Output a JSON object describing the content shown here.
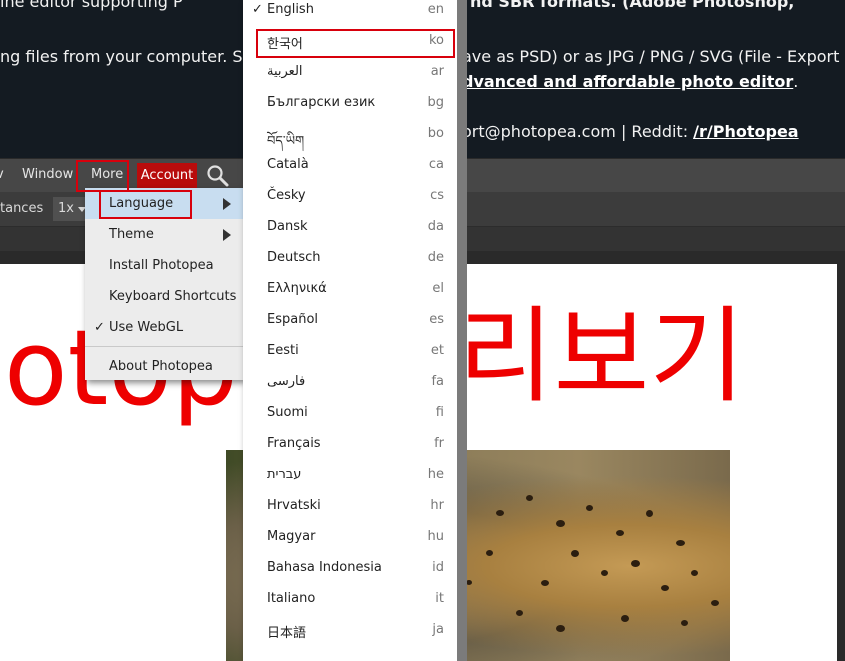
{
  "banner": {
    "line1": "ine editor supporting P",
    "line1b": "nd SBR formats. (Adobe Photoshop,",
    "line2a": "ng files from your computer. Sa",
    "line2b": "ave as PSD) or as JPG / PNG / SVG (File - Export as",
    "line3": "dvanced and affordable photo editor",
    "line3_end": ".",
    "line4a": "ort@photopea.com | Reddit: ",
    "line4b": "/r/Photopea"
  },
  "menubar": {
    "view": "v",
    "window": "Window",
    "more": "More",
    "account": "Account"
  },
  "optbar": {
    "distances": "tances",
    "zoom": "1x"
  },
  "canvas": {
    "text_left": "otope",
    "text_right": "리보기"
  },
  "more_menu": {
    "items": [
      {
        "label": "Language"
      },
      {
        "label": "Theme"
      },
      {
        "label": "Install Photopea"
      },
      {
        "label": "Keyboard Shortcuts"
      },
      {
        "label": "Use WebGL",
        "check": "✓"
      },
      {
        "label": "About Photopea"
      }
    ]
  },
  "languages": [
    {
      "name": "English",
      "code": "en",
      "check": "✓"
    },
    {
      "name": "한국어",
      "code": "ko"
    },
    {
      "name": "العربية",
      "code": "ar"
    },
    {
      "name": "Български език",
      "code": "bg"
    },
    {
      "name": "བོད་ཡིག",
      "code": "bo"
    },
    {
      "name": "Català",
      "code": "ca"
    },
    {
      "name": "Česky",
      "code": "cs"
    },
    {
      "name": "Dansk",
      "code": "da"
    },
    {
      "name": "Deutsch",
      "code": "de"
    },
    {
      "name": "Ελληνικά",
      "code": "el"
    },
    {
      "name": "Español",
      "code": "es"
    },
    {
      "name": "Eesti",
      "code": "et"
    },
    {
      "name": "فارسی",
      "code": "fa"
    },
    {
      "name": "Suomi",
      "code": "fi"
    },
    {
      "name": "Français",
      "code": "fr"
    },
    {
      "name": "עברית",
      "code": "he"
    },
    {
      "name": "Hrvatski",
      "code": "hr"
    },
    {
      "name": "Magyar",
      "code": "hu"
    },
    {
      "name": "Bahasa Indonesia",
      "code": "id"
    },
    {
      "name": "Italiano",
      "code": "it"
    },
    {
      "name": "日本語",
      "code": "ja"
    }
  ],
  "colors": {
    "accent_red": "#d8000c",
    "account_bg": "#b80c0c",
    "highlight": "#c8ddf0"
  }
}
